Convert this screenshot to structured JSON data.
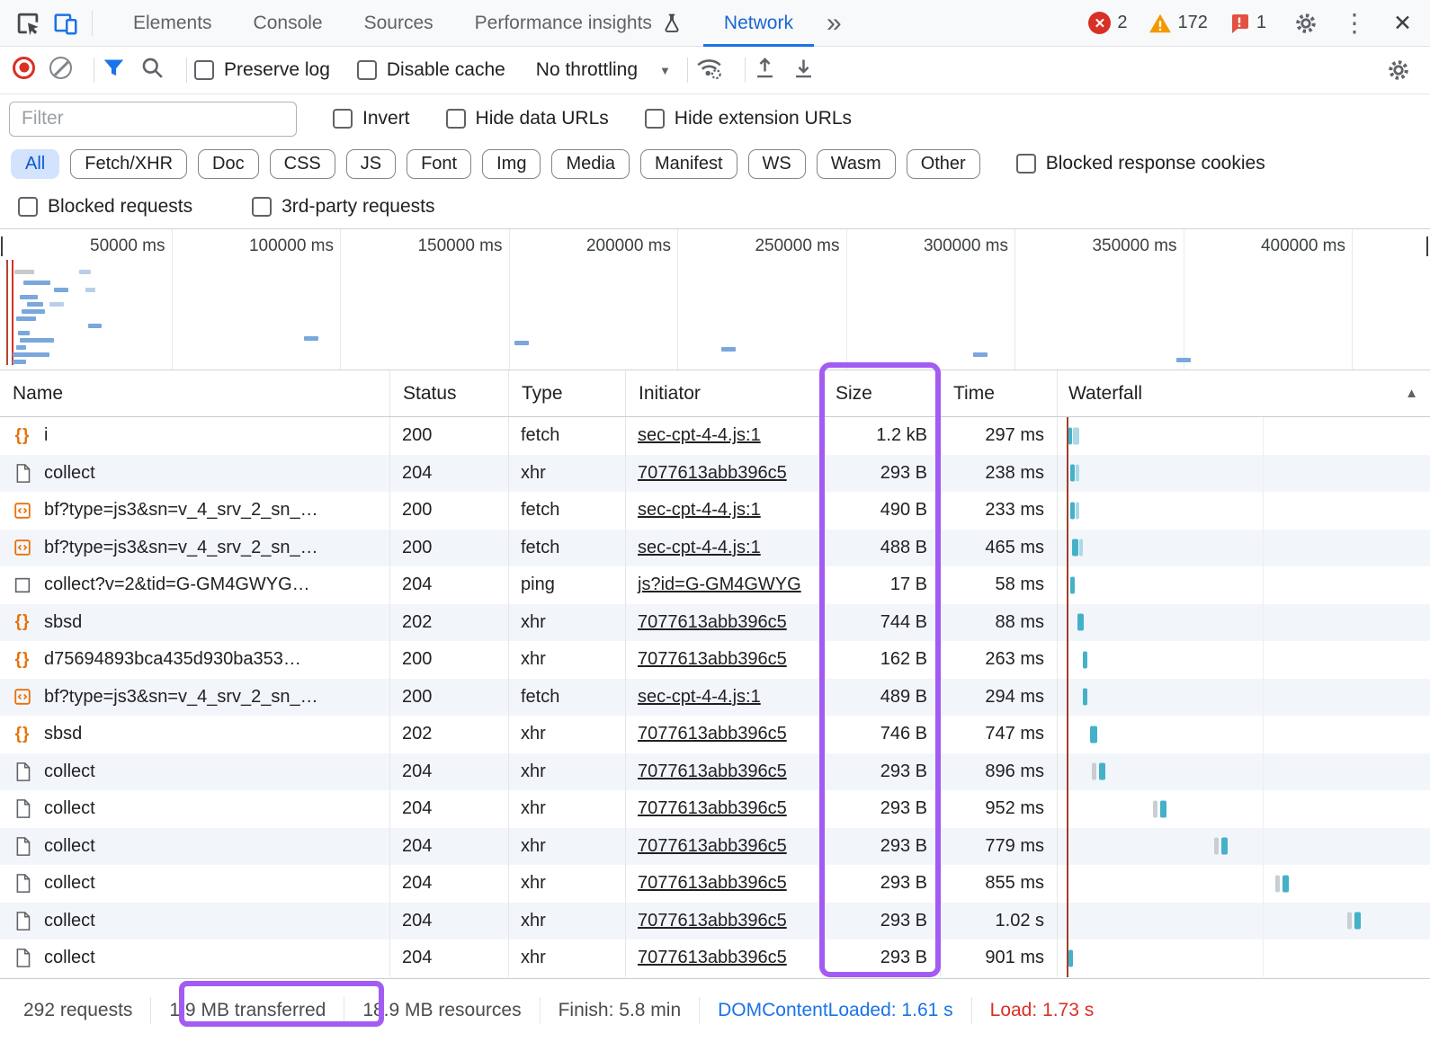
{
  "tabbar": {
    "tabs": [
      "Elements",
      "Console",
      "Sources",
      "Performance insights",
      "Network"
    ],
    "active_tab": "Network",
    "more_tabs": "»",
    "errors": "2",
    "warnings": "172",
    "issues": "1"
  },
  "toolbar": {
    "preserve_log": "Preserve log",
    "disable_cache": "Disable cache",
    "throttling": "No throttling",
    "dropdown_caret": "▼"
  },
  "filterbar": {
    "placeholder": "Filter",
    "invert": "Invert",
    "hide_data_urls": "Hide data URLs",
    "hide_extension_urls": "Hide extension URLs",
    "types": [
      "All",
      "Fetch/XHR",
      "Doc",
      "CSS",
      "JS",
      "Font",
      "Img",
      "Media",
      "Manifest",
      "WS",
      "Wasm",
      "Other"
    ],
    "active_type": "All",
    "blocked_response_cookies": "Blocked response cookies",
    "blocked_requests": "Blocked requests",
    "third_party": "3rd-party requests"
  },
  "overview": {
    "ticks": [
      "50000 ms",
      "100000 ms",
      "150000 ms",
      "200000 ms",
      "250000 ms",
      "300000 ms",
      "350000 ms",
      "400000 ms"
    ],
    "event_lines": [
      {
        "x": 7,
        "color": "#b0452f"
      },
      {
        "x": 13,
        "color": "#d93025"
      }
    ],
    "bars": [
      [
        16,
        45,
        22,
        "g"
      ],
      [
        88,
        45,
        13,
        "lb"
      ],
      [
        26,
        57,
        30,
        "b"
      ],
      [
        60,
        65,
        16,
        "b"
      ],
      [
        95,
        65,
        11,
        "lb"
      ],
      [
        22,
        73,
        20,
        "b"
      ],
      [
        30,
        81,
        18,
        "b"
      ],
      [
        55,
        81,
        16,
        "lb"
      ],
      [
        24,
        89,
        26,
        "b"
      ],
      [
        18,
        97,
        22,
        "b"
      ],
      [
        98,
        105,
        15,
        "b"
      ],
      [
        20,
        113,
        13,
        "b"
      ],
      [
        22,
        121,
        38,
        "b"
      ],
      [
        18,
        129,
        11,
        "b"
      ],
      [
        14,
        137,
        41,
        "b"
      ],
      [
        14,
        145,
        15,
        "b"
      ],
      [
        338,
        119,
        16,
        "b"
      ],
      [
        572,
        124,
        16,
        "b"
      ],
      [
        802,
        131,
        16,
        "b"
      ],
      [
        1082,
        137,
        16,
        "b"
      ],
      [
        1308,
        143,
        16,
        "b"
      ]
    ]
  },
  "table": {
    "columns": [
      "Name",
      "Status",
      "Type",
      "Initiator",
      "Size",
      "Time",
      "Waterfall"
    ],
    "sort_icon": "▲",
    "rows": [
      {
        "icon": "braces",
        "name": "i",
        "status": "200",
        "type": "fetch",
        "initiator": "sec-cpt-4-4.js:1",
        "size": "1.2 kB",
        "time": "297 ms",
        "wf": [
          [
            12,
            4,
            "d"
          ],
          [
            17,
            7,
            "l"
          ]
        ]
      },
      {
        "icon": "document",
        "name": "collect",
        "status": "204",
        "type": "xhr",
        "initiator": "7077613abb396c5",
        "size": "293 B",
        "time": "238 ms",
        "wf": [
          [
            14,
            5,
            "d"
          ],
          [
            20,
            4,
            "l"
          ]
        ]
      },
      {
        "icon": "script",
        "name": "bf?type=js3&sn=v_4_srv_2_sn_…",
        "status": "200",
        "type": "fetch",
        "initiator": "sec-cpt-4-4.js:1",
        "size": "490 B",
        "time": "233 ms",
        "wf": [
          [
            14,
            5,
            "d"
          ],
          [
            20,
            4,
            "l"
          ]
        ]
      },
      {
        "icon": "script",
        "name": "bf?type=js3&sn=v_4_srv_2_sn_…",
        "status": "200",
        "type": "fetch",
        "initiator": "sec-cpt-4-4.js:1",
        "size": "488 B",
        "time": "465 ms",
        "wf": [
          [
            16,
            7,
            "d"
          ],
          [
            24,
            4,
            "l"
          ]
        ]
      },
      {
        "icon": "square",
        "name": "collect?v=2&tid=G-GM4GWYG…",
        "status": "204",
        "type": "ping",
        "initiator": "js?id=G-GM4GWYG",
        "size": "17 B",
        "time": "58 ms",
        "wf": [
          [
            14,
            5,
            "d"
          ]
        ]
      },
      {
        "icon": "braces",
        "name": "sbsd",
        "status": "202",
        "type": "xhr",
        "initiator": "7077613abb396c5",
        "size": "744 B",
        "time": "88 ms",
        "wf": [
          [
            22,
            7,
            "d"
          ]
        ]
      },
      {
        "icon": "braces",
        "name": "d75694893bca435d930ba353…",
        "status": "200",
        "type": "xhr",
        "initiator": "7077613abb396c5",
        "size": "162 B",
        "time": "263 ms",
        "wf": [
          [
            28,
            5,
            "d"
          ]
        ]
      },
      {
        "icon": "script",
        "name": "bf?type=js3&sn=v_4_srv_2_sn_…",
        "status": "200",
        "type": "fetch",
        "initiator": "sec-cpt-4-4.js:1",
        "size": "489 B",
        "time": "294 ms",
        "wf": [
          [
            28,
            5,
            "d"
          ]
        ]
      },
      {
        "icon": "braces",
        "name": "sbsd",
        "status": "202",
        "type": "xhr",
        "initiator": "7077613abb396c5",
        "size": "746 B",
        "time": "747 ms",
        "wf": [
          [
            36,
            8,
            "d"
          ]
        ]
      },
      {
        "icon": "document",
        "name": "collect",
        "status": "204",
        "type": "xhr",
        "initiator": "7077613abb396c5",
        "size": "293 B",
        "time": "896 ms",
        "wf": [
          [
            38,
            5,
            "g"
          ],
          [
            46,
            7,
            "d"
          ]
        ]
      },
      {
        "icon": "document",
        "name": "collect",
        "status": "204",
        "type": "xhr",
        "initiator": "7077613abb396c5",
        "size": "293 B",
        "time": "952 ms",
        "wf": [
          [
            106,
            5,
            "g"
          ],
          [
            114,
            7,
            "d"
          ]
        ]
      },
      {
        "icon": "document",
        "name": "collect",
        "status": "204",
        "type": "xhr",
        "initiator": "7077613abb396c5",
        "size": "293 B",
        "time": "779 ms",
        "wf": [
          [
            174,
            5,
            "g"
          ],
          [
            182,
            7,
            "d"
          ]
        ]
      },
      {
        "icon": "document",
        "name": "collect",
        "status": "204",
        "type": "xhr",
        "initiator": "7077613abb396c5",
        "size": "293 B",
        "time": "855 ms",
        "wf": [
          [
            242,
            5,
            "g"
          ],
          [
            250,
            7,
            "d"
          ]
        ]
      },
      {
        "icon": "document",
        "name": "collect",
        "status": "204",
        "type": "xhr",
        "initiator": "7077613abb396c5",
        "size": "293 B",
        "time": "1.02 s",
        "wf": [
          [
            322,
            5,
            "g"
          ],
          [
            330,
            7,
            "d"
          ]
        ]
      },
      {
        "icon": "document",
        "name": "collect",
        "status": "204",
        "type": "xhr",
        "initiator": "7077613abb396c5",
        "size": "293 B",
        "time": "901 ms",
        "wf": [
          [
            12,
            5,
            "d"
          ]
        ]
      }
    ]
  },
  "statusbar": {
    "requests": "292 requests",
    "transferred": "1.9 MB transferred",
    "resources": "18.9 MB resources",
    "finish": "Finish: 5.8 min",
    "dcl": "DOMContentLoaded: 1.61 s",
    "load": "Load: 1.73 s"
  },
  "colors": {
    "accent": "#1a73e8",
    "error": "#d93025",
    "warning": "#f29900",
    "script_orange": "#e8710a",
    "annotation": "#a35cf2",
    "waterfall_dark": "#45b1c9",
    "waterfall_light": "#a9d9e6",
    "waterfall_gray": "#c9ced3",
    "overview_bar": "#7aa7dc"
  }
}
